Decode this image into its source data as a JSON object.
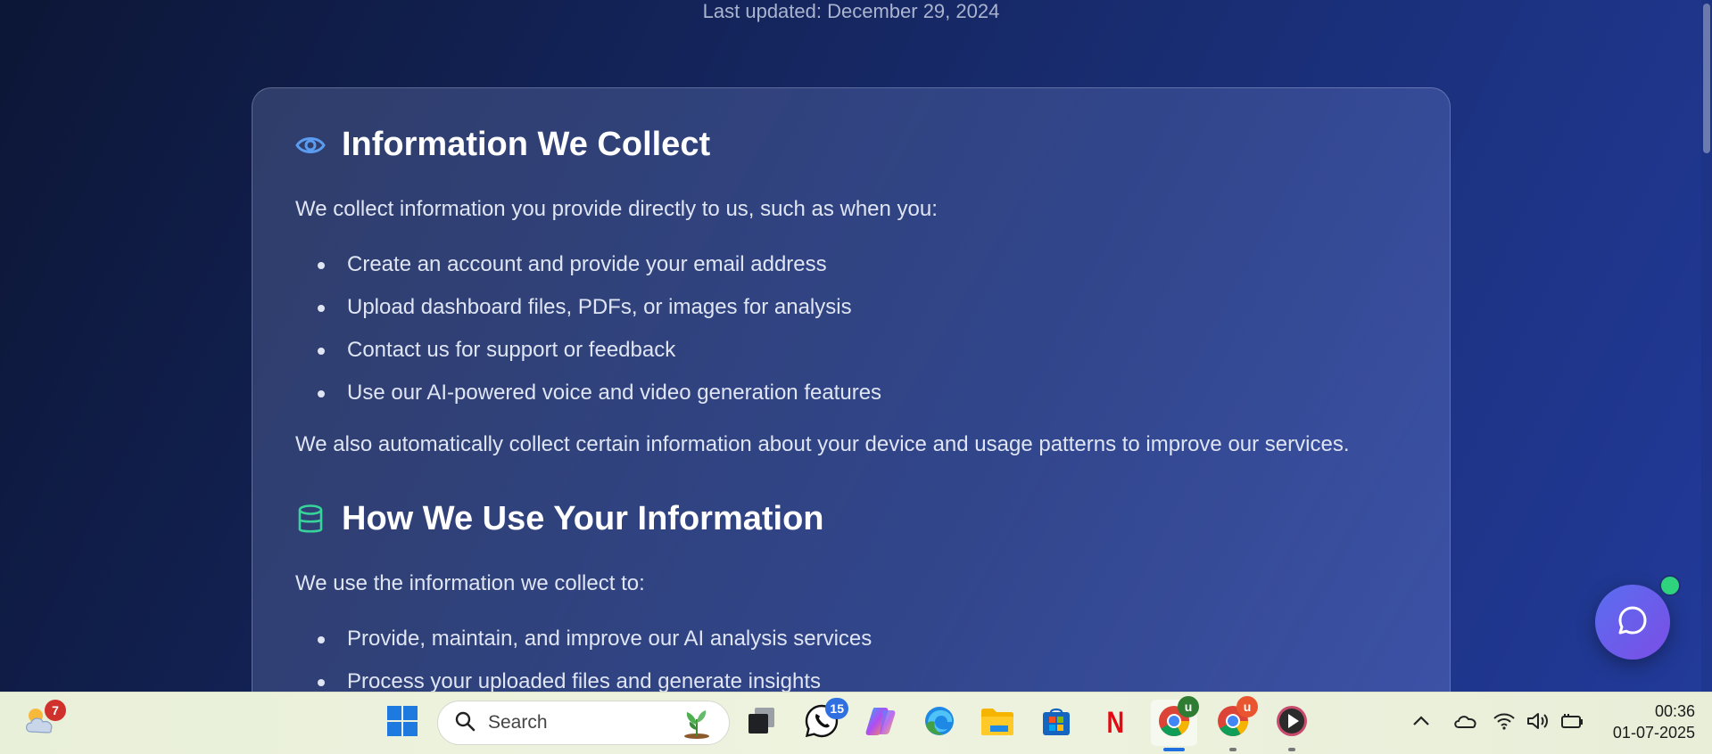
{
  "page": {
    "last_updated": "Last updated: December 29, 2024",
    "sections": [
      {
        "title": "Information We Collect",
        "icon": "eye-icon",
        "intro": "We collect information you provide directly to us, such as when you:",
        "items": [
          "Create an account and provide your email address",
          "Upload dashboard files, PDFs, or images for analysis",
          "Contact us for support or feedback",
          "Use our AI-powered voice and video generation features"
        ],
        "outro": "We also automatically collect certain information about your device and usage patterns to improve our services."
      },
      {
        "title": "How We Use Your Information",
        "icon": "database-icon",
        "intro": "We use the information we collect to:",
        "items": [
          "Provide, maintain, and improve our AI analysis services",
          "Process your uploaded files and generate insights"
        ]
      }
    ],
    "chat_button": {
      "icon": "chat-bubble-icon",
      "status_color": "#2fd27d"
    }
  },
  "taskbar": {
    "weather": {
      "icon": "weather-cloud-icon",
      "badge": "7"
    },
    "search": {
      "placeholder": "Search"
    },
    "apps": [
      {
        "name": "windows-start",
        "icon": "windows-logo-icon"
      },
      {
        "name": "task-view",
        "icon": "task-view-icon"
      },
      {
        "name": "whatsapp",
        "icon": "whatsapp-icon",
        "badge": "15"
      },
      {
        "name": "copilot",
        "icon": "copilot-icon"
      },
      {
        "name": "edge",
        "icon": "edge-icon"
      },
      {
        "name": "file-explorer",
        "icon": "folder-icon"
      },
      {
        "name": "microsoft-store",
        "icon": "store-icon"
      },
      {
        "name": "netflix",
        "icon": "netflix-icon",
        "label": "N"
      },
      {
        "name": "chrome-profile-1",
        "icon": "chrome-icon",
        "badge": "u"
      },
      {
        "name": "chrome-profile-2",
        "icon": "chrome-icon",
        "badge": "u"
      },
      {
        "name": "media-player",
        "icon": "media-player-icon"
      }
    ],
    "tray_icons": [
      "chevron-up-icon",
      "onedrive-cloud-icon",
      "wifi-icon",
      "volume-icon",
      "battery-icon"
    ],
    "clock": {
      "time": "00:36",
      "date": "01-07-2025"
    }
  },
  "colors": {
    "accent_eye": "#5b9bf0",
    "accent_db": "#37d39a",
    "badge_red": "#d0312d",
    "badge_blue": "#2f6fe0",
    "badge_green": "#2e7d32",
    "badge_orange": "#e8552e"
  }
}
